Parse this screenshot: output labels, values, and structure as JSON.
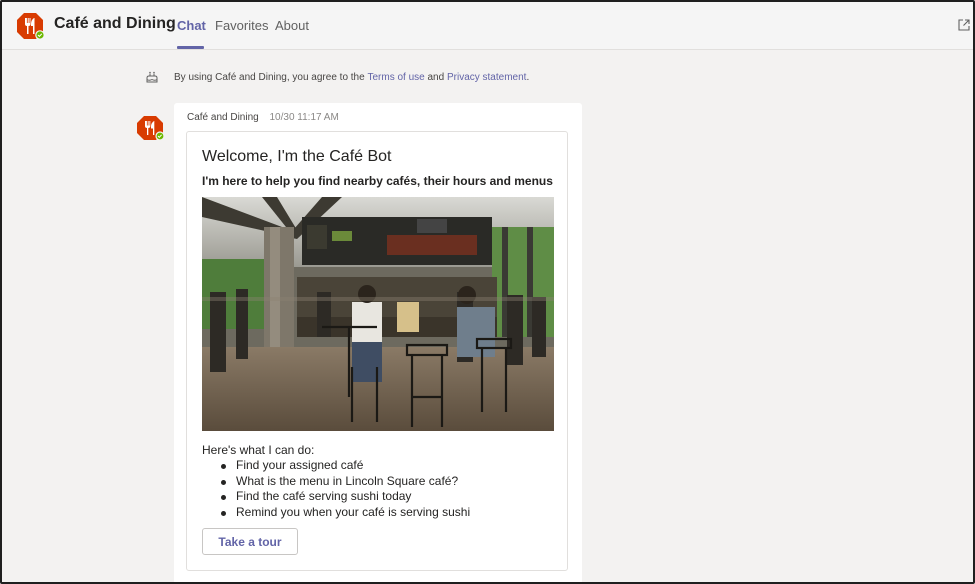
{
  "header": {
    "app_title": "Café and Dining",
    "tabs": [
      {
        "label": "Chat",
        "active": true
      },
      {
        "label": "Favorites",
        "active": false
      },
      {
        "label": "About",
        "active": false
      }
    ],
    "icons": {
      "app": "fork-knife-icon",
      "popout": "popout-icon"
    }
  },
  "notice": {
    "prefix": "By using Café and Dining, you agree to the ",
    "terms_link": "Terms of use",
    "middle": " and ",
    "privacy_link": "Privacy statement",
    "suffix": "."
  },
  "message": {
    "sender": "Café and Dining",
    "timestamp": "10/30 11:17 AM",
    "card": {
      "title": "Welcome, I'm the Café Bot",
      "subtitle": "I'm here to help you find nearby cafés, their hours and menus",
      "intro": "Here's what I can do:",
      "capabilities": [
        "Find your assigned café",
        "What is the menu in Lincoln Square café?",
        "Find the café serving sushi today",
        "Remind you when your café is serving sushi"
      ],
      "button_label": "Take a tour"
    }
  },
  "colors": {
    "accent": "#6264a7",
    "app_icon": "#d83b01",
    "status_available": "#6bb700",
    "background": "#f3f2f1"
  }
}
